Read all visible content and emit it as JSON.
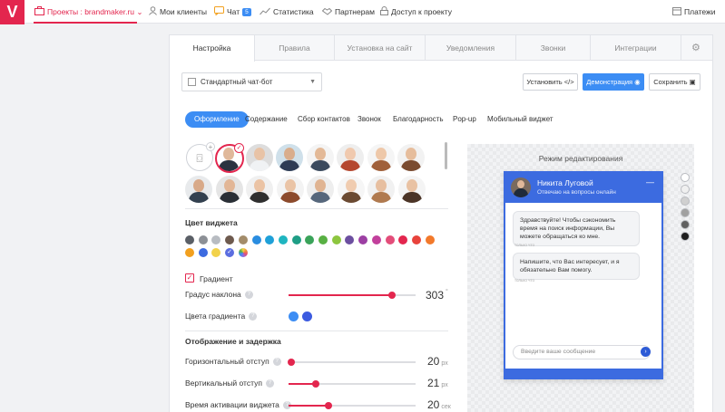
{
  "nav": {
    "logo": "V",
    "projects": "Проекты : brandmaker.ru",
    "clients": "Мои клиенты",
    "chat": "Чат",
    "chat_badge": "5",
    "stats": "Статистика",
    "partners": "Партнерам",
    "access": "Доступ к проекту",
    "payments": "Платежи"
  },
  "tabs": [
    "Настройка",
    "Правила",
    "Установка на сайт",
    "Уведомления",
    "Звонки",
    "Интеграции"
  ],
  "toolbar": {
    "bot_select": "Стандартный чат-бот",
    "install": "Установить </>",
    "demo": "Демонстрация",
    "save": "Сохранить"
  },
  "subtabs": [
    "Оформление",
    "Содержание",
    "Сбор контактов",
    "Звонок",
    "Благодарность",
    "Pop-up",
    "Мобильный виджет"
  ],
  "colors": {
    "accent": "#e3264e",
    "primary": "#3c8df4",
    "widget": "#3c6be0",
    "swatches": [
      "#5a5f66",
      "#8c9096",
      "#b8bcc2",
      "#6e5a4e",
      "#a38c6a",
      "#2a8de0",
      "#1fa0d8",
      "#1fb5c0",
      "#1f9e86",
      "#3aa35a",
      "#58b043",
      "#8dc63f",
      "#6c4fa0",
      "#9c3fa3",
      "#c2409c",
      "#e34d7a",
      "#e3264e",
      "#e8433c",
      "#f2792b",
      "#f2a01e",
      "#3c6be0",
      "#f2d24a"
    ],
    "gradient": [
      "#3c8df4",
      "#3c5be0"
    ]
  },
  "appearance": {
    "widget_color_title": "Цвет виджета",
    "gradient_label": "Градиент",
    "gradient_angle_label": "Градус наклона",
    "gradient_angle_value": "303",
    "gradient_angle_unit": "°",
    "gradient_colors_label": "Цвета градиента"
  },
  "display": {
    "title": "Отображение и задержка",
    "horizontal_label": "Горизонтальный отступ",
    "horizontal_value": "20",
    "horizontal_unit": "px",
    "vertical_label": "Вертикальный отступ",
    "vertical_value": "21",
    "vertical_unit": "px",
    "activation_label": "Время активации виджета",
    "activation_value": "20",
    "activation_unit": "сек"
  },
  "preview": {
    "title": "Режим редактирования",
    "operator_name": "Никита Луговой",
    "operator_status": "Отвечаю на вопросы онлайн",
    "msg1": "Здравствуйте! Чтобы сэкономить время на поиск информации, Вы можете обращаться ко мне.",
    "msg2": "Напишите, что Вас интересует, и я обязательно Вам помогу.",
    "time1": "только что",
    "time2": "только что",
    "input_placeholder": "Введите ваше сообщение",
    "themes": [
      "#ffffff",
      "#f0f0f0",
      "#d0d0d0",
      "#a0a0a0",
      "#606060",
      "#1e1e1e"
    ]
  }
}
